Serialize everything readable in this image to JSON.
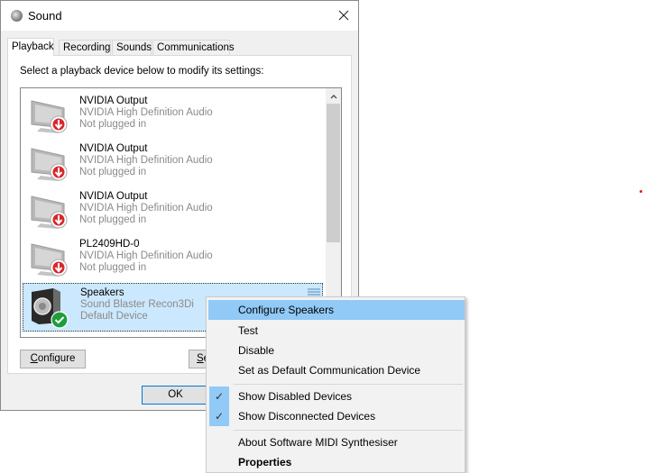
{
  "window": {
    "title": "Sound",
    "close_icon": "close-icon"
  },
  "tabs": [
    {
      "label": "Playback",
      "active": true
    },
    {
      "label": "Recording",
      "active": false
    },
    {
      "label": "Sounds",
      "active": false
    },
    {
      "label": "Communications",
      "active": false
    }
  ],
  "playback": {
    "instruction": "Select a playback device below to modify its settings:",
    "devices": [
      {
        "name": "NVIDIA Output",
        "description": "NVIDIA High Definition Audio",
        "status": "Not plugged in",
        "icon": "monitor-icon",
        "badge": "unplugged-arrow-icon",
        "selected": false
      },
      {
        "name": "NVIDIA Output",
        "description": "NVIDIA High Definition Audio",
        "status": "Not plugged in",
        "icon": "monitor-icon",
        "badge": "unplugged-arrow-icon",
        "selected": false
      },
      {
        "name": "NVIDIA Output",
        "description": "NVIDIA High Definition Audio",
        "status": "Not plugged in",
        "icon": "monitor-icon",
        "badge": "unplugged-arrow-icon",
        "selected": false
      },
      {
        "name": "PL2409HD-0",
        "description": "NVIDIA High Definition Audio",
        "status": "Not plugged in",
        "icon": "monitor-icon",
        "badge": "unplugged-arrow-icon",
        "selected": false
      },
      {
        "name": "Speakers",
        "description": "Sound Blaster Recon3Di",
        "status": "Default Device",
        "icon": "speaker-icon",
        "badge": "default-check-icon",
        "selected": true
      }
    ],
    "configure_button": {
      "label_mnemonic": "C",
      "label_rest": "onfigure"
    },
    "set_default_button": {
      "label_mnemonic": "S",
      "label_rest": "e"
    },
    "ok_button": "OK"
  },
  "context_menu": {
    "items": [
      {
        "label": "Configure Speakers",
        "highlighted": true,
        "checked": false,
        "bold": false
      },
      {
        "label": "Test",
        "highlighted": false,
        "checked": false,
        "bold": false
      },
      {
        "label": "Disable",
        "highlighted": false,
        "checked": false,
        "bold": false
      },
      {
        "label": "Set as Default Communication Device",
        "highlighted": false,
        "checked": false,
        "bold": false
      },
      {
        "label": "Show Disabled Devices",
        "highlighted": false,
        "checked": true,
        "bold": false
      },
      {
        "label": "Show Disconnected Devices",
        "highlighted": false,
        "checked": true,
        "bold": false
      },
      {
        "label": "About Software MIDI Synthesiser",
        "highlighted": false,
        "checked": false,
        "bold": false
      },
      {
        "label": "Properties",
        "highlighted": false,
        "checked": false,
        "bold": true
      }
    ],
    "check_glyph": "✓"
  },
  "colors": {
    "selection": "#cce8ff",
    "menu_highlight": "#91c9f7",
    "default_badge": "#1e9e3a",
    "unplugged_badge": "#d9262a",
    "focus_border": "#0078d7"
  }
}
